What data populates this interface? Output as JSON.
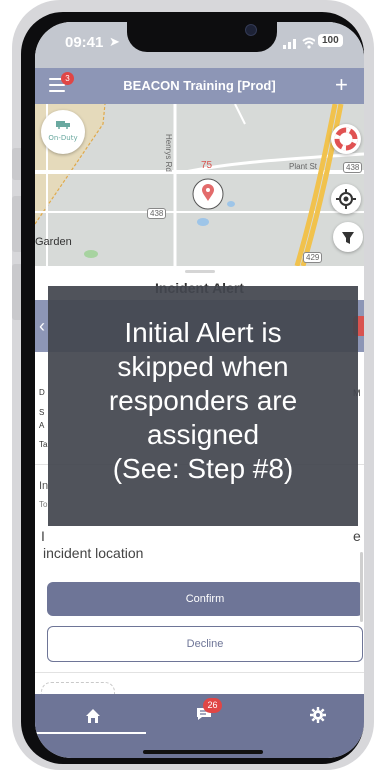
{
  "status_bar": {
    "time": "09:41",
    "battery": "100"
  },
  "header": {
    "title": "BEACON Training [Prod]",
    "menu_badge": "3"
  },
  "map": {
    "duty_label": "On-Duty",
    "road_number_1": "75",
    "road_number_2": "438",
    "road_number_3": "438",
    "road_number_4": "429",
    "street_label_1": "Plant St",
    "street_label_2": "Henrys Rd",
    "place_label": "Garden"
  },
  "sheet": {
    "title": "Incident Alert",
    "confirm_label": "Confirm",
    "decline_label": "Decline",
    "partial_text_location": "incident location"
  },
  "overlay": {
    "lines": [
      "Initial Alert is",
      "skipped when",
      "responders are",
      "assigned",
      "(See: Step #8)"
    ]
  },
  "tabbar": {
    "message_badge": "26"
  },
  "colors": {
    "header": "#8d96b6",
    "primary": "#6e7597",
    "badge": "#e04646",
    "overlay": "#43464f"
  }
}
